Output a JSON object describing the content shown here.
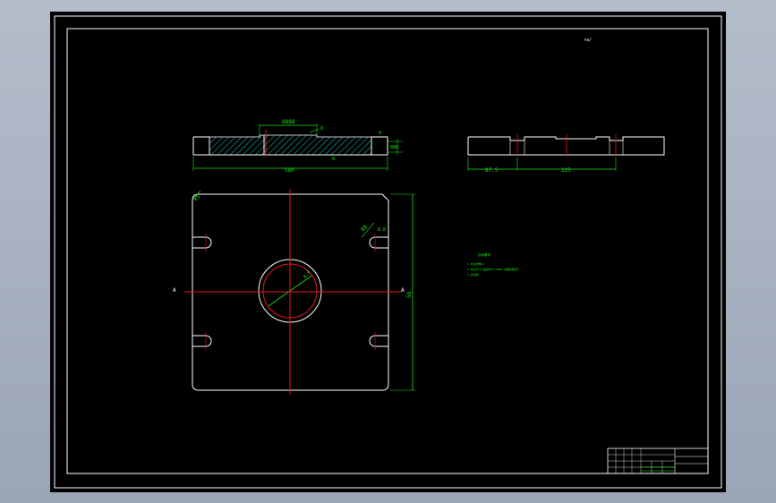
{
  "drawing": {
    "corner_note": "ra/",
    "section_view": {
      "dim_top": "8888",
      "dim_right": "888",
      "dim_overall": "580",
      "leader_label": "0"
    },
    "side_view": {
      "dim_left": "87.5",
      "dim_right": "125"
    },
    "plan_view": {
      "corner_label": "R5",
      "slot_label": "R8",
      "hole_label": "8.8",
      "bore_label": "8.8",
      "section_marker_left": "A",
      "section_marker_right": "A",
      "height_dim": "58"
    },
    "notes": {
      "title": "技术要求",
      "lines": [
        "1.未注倒角C1",
        "2.未注尺寸公差按GB/T1804-m级要求执行",
        "3.去毛刺"
      ]
    },
    "title_block": {
      "cells": [
        "",
        "",
        "",
        "",
        "",
        ""
      ]
    }
  },
  "colors": {
    "background": "#000000",
    "outline": "#ffffff",
    "dimension": "#19e619",
    "centerline": "#e61919",
    "hatch": "#1ec8c8"
  }
}
